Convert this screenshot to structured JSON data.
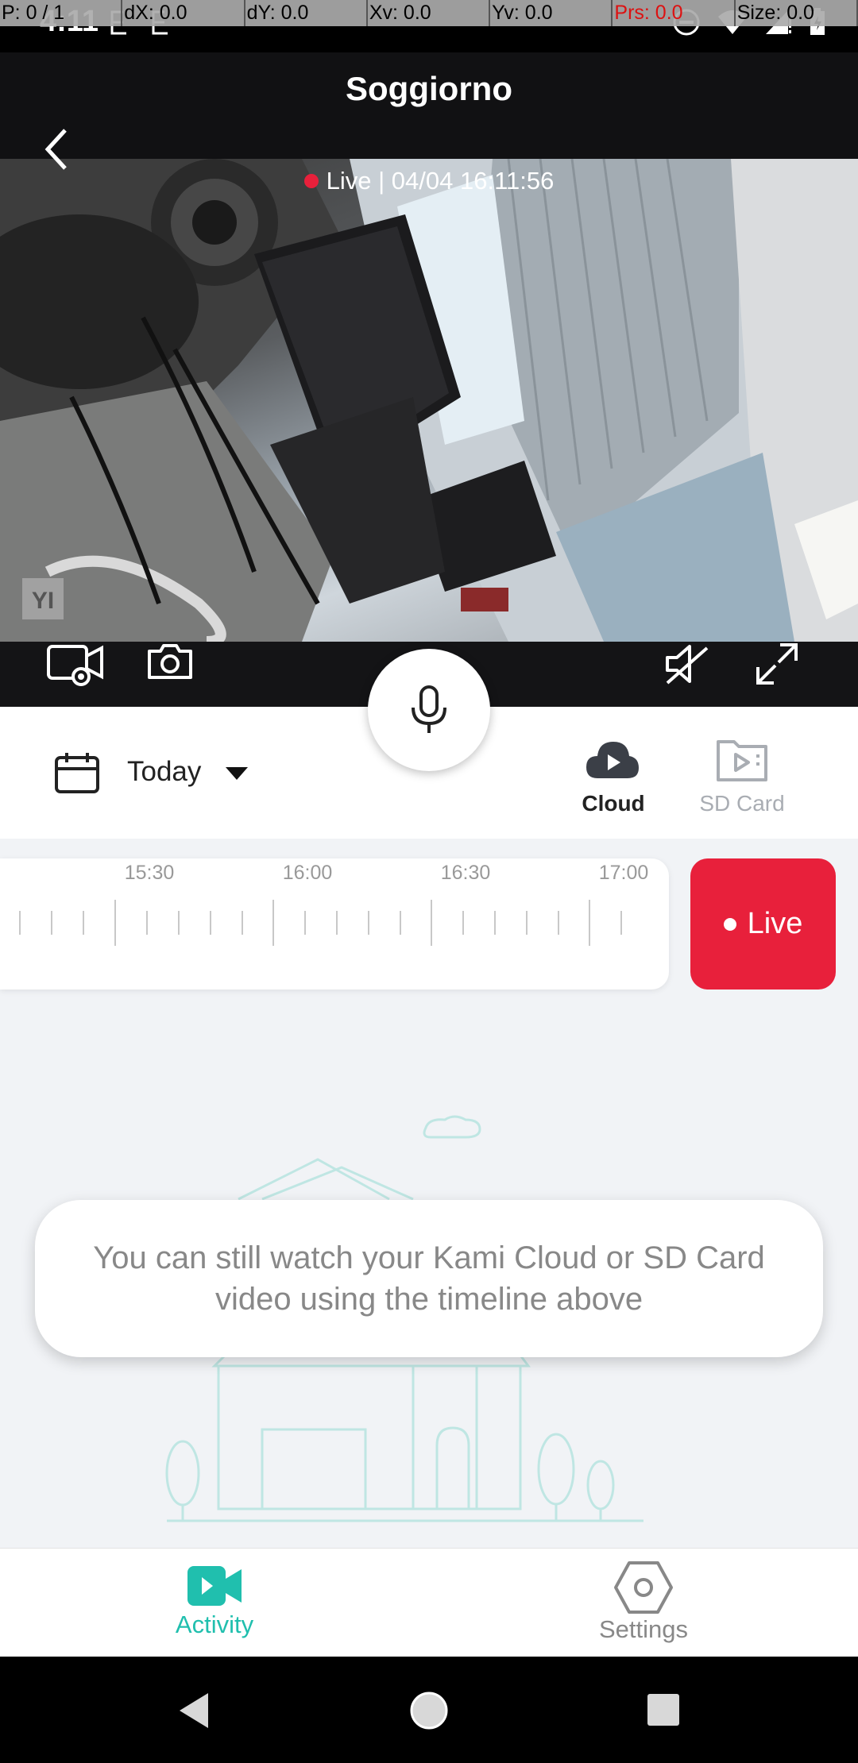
{
  "debug": {
    "fields": [
      "P: 0 / 1",
      "dX: 0.0",
      "dY: 0.0",
      "Xv: 0.0",
      "Yv: 0.0",
      "Prs: 0.0",
      "Size: 0.0"
    ]
  },
  "statusbar": {
    "time": "4:11"
  },
  "header": {
    "title": "Soggiorno",
    "subtitle": "Live | 04/04 16:11:56"
  },
  "feed": {
    "watermark": "YI"
  },
  "date_selector": {
    "label": "Today"
  },
  "sources": {
    "cloud": "Cloud",
    "sd": "SD Card"
  },
  "timeline": {
    "labels": [
      "15:30",
      "16:00",
      "16:30",
      "17:00"
    ],
    "live_label": "Live"
  },
  "toast": {
    "message": "You can still watch your Kami Cloud or SD Card video using the timeline above"
  },
  "bottom_nav": {
    "activity": "Activity",
    "settings": "Settings"
  },
  "colors": {
    "accent": "#20bfae",
    "live_red": "#e8203b"
  }
}
